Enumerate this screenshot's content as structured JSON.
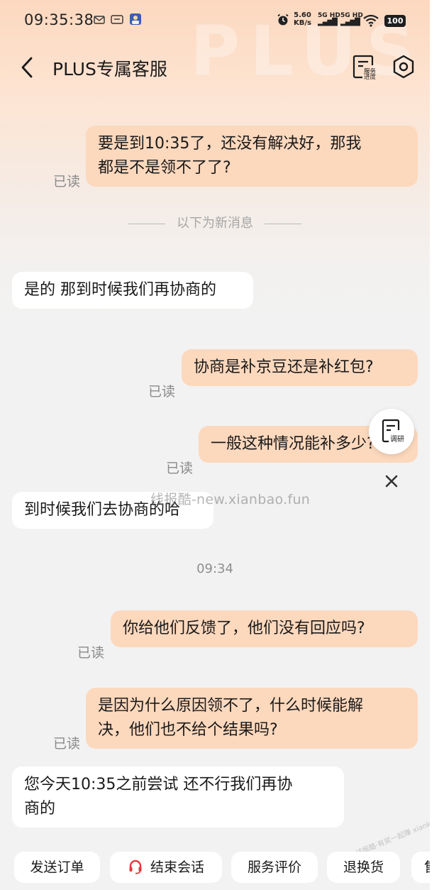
{
  "status_bar": {
    "time": "09:35:38",
    "net_speed_value": "5.60",
    "net_speed_unit": "KB/s",
    "signal_1": "5G HD",
    "signal_2": "5G HD",
    "battery": "100"
  },
  "header": {
    "title": "PLUS专属客服",
    "progress_label_1": "服务",
    "progress_label_2": "进度",
    "watermark": "PLUS"
  },
  "messages": [
    {
      "side": "out",
      "text_1": "要是到10:35了，还没有解决好，那我",
      "text_2": "都是不是领不了了?",
      "read": "已读"
    },
    {
      "side": "system",
      "text": "以下为新消息"
    },
    {
      "side": "in",
      "text": "是的 那到时候我们再协商的"
    },
    {
      "side": "out",
      "text": "协商是补京豆还是补红包?",
      "read": "已读"
    },
    {
      "side": "out",
      "text": "一般这种情况能补多少?",
      "read": "已读"
    },
    {
      "side": "in",
      "text": "到时候我们去协商的哈"
    },
    {
      "side": "time",
      "text": "09:34"
    },
    {
      "side": "out",
      "text": "你给他们反馈了，他们没有回应吗?",
      "read": "已读"
    },
    {
      "side": "out",
      "text_1": "是因为什么原因领不了，什么时候能解",
      "text_2": "决，他们也不给个结果吗?",
      "read": "已读"
    },
    {
      "side": "in",
      "text_1": "您今天10:35之前尝试 还不行我们再协",
      "text_2": "商的"
    }
  ],
  "survey": {
    "label": "调研"
  },
  "watermarks": {
    "site": "线报酷-new.xianbao.fun",
    "corner": "线报酷·有奖一起赚 xianke8.com"
  },
  "quick_actions": [
    {
      "label": "发送订单"
    },
    {
      "label": "结束会话",
      "icon": "headset-icon"
    },
    {
      "label": "服务评价"
    },
    {
      "label": "退换货"
    },
    {
      "label": "售"
    }
  ],
  "colors": {
    "accent": "#fcd8bd",
    "headset": "#e4393c"
  }
}
